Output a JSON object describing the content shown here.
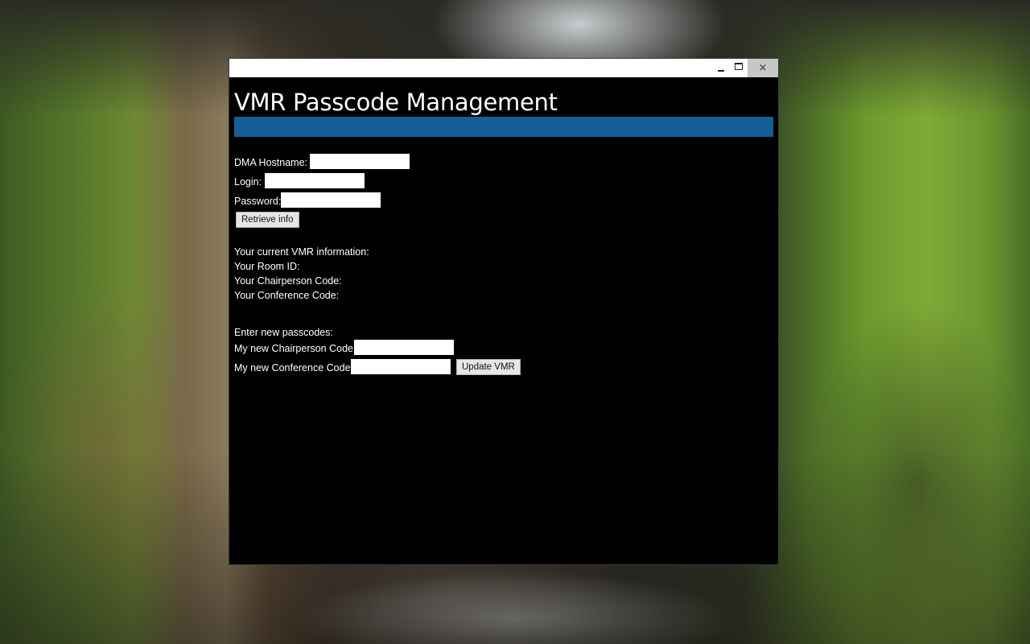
{
  "window": {
    "controls": {
      "minimize_icon": "minimize-icon",
      "maximize_icon": "maximize-icon",
      "close_glyph": "×"
    }
  },
  "app": {
    "title": "VMR Passcode Management",
    "accent_color": "#155f96"
  },
  "login_form": {
    "hostname_label": "DMA Hostname:",
    "hostname_value": "",
    "login_label": "Login:",
    "login_value": "",
    "password_label": "Password:",
    "password_value": "",
    "retrieve_button": "Retrieve info"
  },
  "vmr_info": {
    "heading": "Your current VMR information:",
    "room_id_label": "Your Room ID:",
    "chairperson_label": "Your Chairperson Code:",
    "conference_label": "Your Conference Code:"
  },
  "update_form": {
    "heading": "Enter new passcodes:",
    "new_chairperson_label": "My new Chairperson Code:",
    "new_chairperson_value": "",
    "new_conference_label": "My new Conference Code:",
    "new_conference_value": "",
    "update_button": "Update VMR"
  }
}
